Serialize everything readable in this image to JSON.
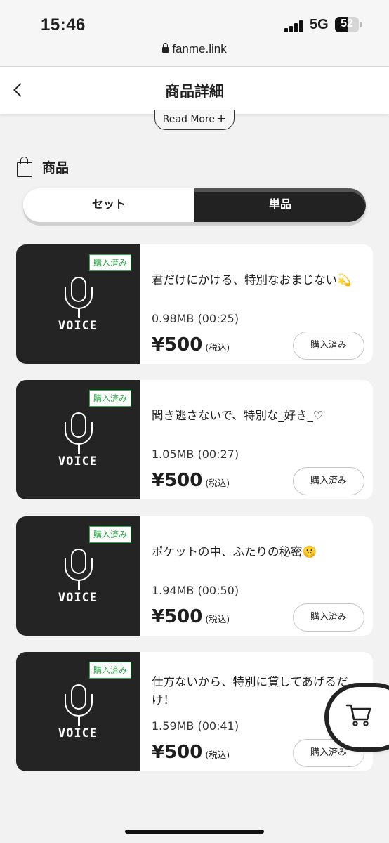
{
  "status_bar": {
    "time": "15:46",
    "network": "5G",
    "battery": "52"
  },
  "url_bar": {
    "domain": "fanme.link"
  },
  "header": {
    "title": "商品詳細"
  },
  "description": {
    "read_more": "Read More"
  },
  "section": {
    "title": "商品"
  },
  "tabs": {
    "set": "セット",
    "single": "単品",
    "selected": "単品"
  },
  "products": [
    {
      "badge": "購入済み",
      "thumb_label": "VOICE",
      "name": "君だけにかける、特別なおまじない💫",
      "size": "0.98MB (00:25)",
      "price": "¥500",
      "tax": "(税込)",
      "button": "購入済み"
    },
    {
      "badge": "購入済み",
      "thumb_label": "VOICE",
      "name": "聞き逃さないで、特別な_好き_♡",
      "size": "1.05MB (00:27)",
      "price": "¥500",
      "tax": "(税込)",
      "button": "購入済み"
    },
    {
      "badge": "購入済み",
      "thumb_label": "VOICE",
      "name": "ポケットの中、ふたりの秘密🤫",
      "size": "1.94MB (00:50)",
      "price": "¥500",
      "tax": "(税込)",
      "button": "購入済み"
    },
    {
      "badge": "購入済み",
      "thumb_label": "VOICE",
      "name": "仕方ないから、特別に貸してあげるだけ！",
      "size": "1.59MB (00:41)",
      "price": "¥500",
      "tax": "(税込)",
      "button": "購入済み"
    }
  ],
  "colors": {
    "accent": "#222222",
    "badge_green": "#2eac49",
    "background": "#f2f2f2"
  },
  "icons": {
    "back": "chevron-left-icon",
    "cart": "cart-icon",
    "bag": "shopping-bag-icon",
    "mic": "microphone-icon"
  }
}
